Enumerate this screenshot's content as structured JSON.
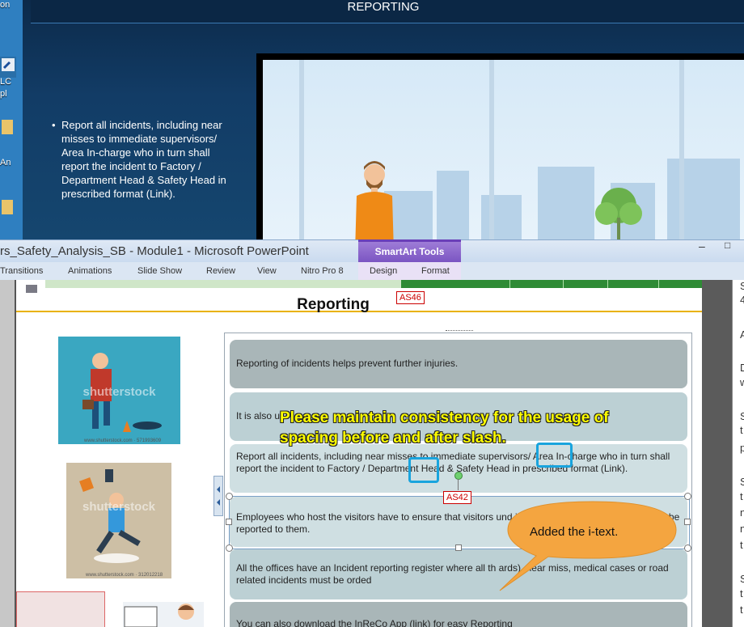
{
  "desktop": {
    "labels": [
      "on",
      "LC",
      "pl",
      "An"
    ]
  },
  "slideshow": {
    "title": "REPORTING",
    "bullet": "Report all incidents, including near misses to immediate supervisors/ Area In-charge who in turn shall report the incident to Factory / Department Head & Safety Head in prescribed format (Link)."
  },
  "window": {
    "title": "rs_Safety_Analysis_SB - Module1  -  Microsoft PowerPoint",
    "contextual_group": "SmartArt Tools",
    "minimize": "–",
    "maximize": "□"
  },
  "ribbon": {
    "tabs": [
      "Transitions",
      "Animations",
      "Slide Show",
      "Review",
      "View",
      "Nitro Pro 8"
    ],
    "contextual_tabs": [
      "Design",
      "Format"
    ]
  },
  "slide": {
    "heading": "Reporting",
    "tag_heading": "AS46",
    "tag_box": "AS42",
    "image1_watermark": "shutterstock",
    "image1_caption": "www.shutterstock.com · 571993609",
    "image2_watermark": "shutterstock",
    "image2_caption": "www.shutterstock.com · 312012218",
    "boxes": [
      "Reporting of incidents helps prevent further injuries.",
      "It is also u",
      "Report all incidents, including near misses to immediate supervisors/ Area In-charge who in turn shall report the incident to Factory / Department Head & Safety Head in prescribed format (Link).",
      "Employees who host the visitors have to ensure that visitors und                        idents, including near misses, must be reported to them.",
      "All the offices have an Incident reporting register where all th                              ards), near miss, medical cases or road related incidents must be            orded",
      "You can also download the InReCo App (link) for easy Reporting"
    ]
  },
  "annotations": {
    "comment_line1": "Please maintain consistency for the usage of",
    "comment_line2": "spacing before and after slash.",
    "callout": "Added the i-text.",
    "highlight_color": "#19a4dd",
    "comment_color": "#ffff00",
    "callout_color": "#f4a540"
  },
  "notes_pane": {
    "letters": [
      "S",
      "4",
      "A",
      "D",
      "w",
      "S",
      "t",
      "p",
      "S",
      "t",
      "n",
      "n",
      "t",
      "S",
      "t",
      "t"
    ]
  }
}
